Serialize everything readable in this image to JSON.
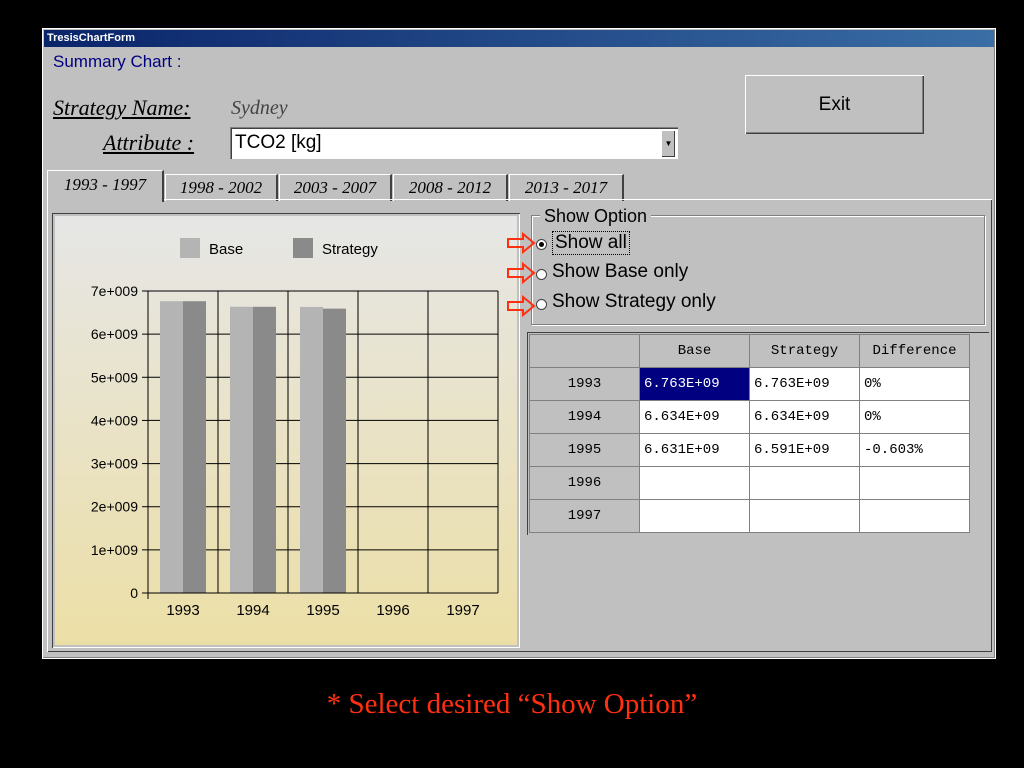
{
  "window": {
    "title": "TresisChartForm"
  },
  "header": {
    "summary_label": "Summary Chart :",
    "strategy_label": "Strategy Name:",
    "strategy_value": "Sydney",
    "attribute_label": "Attribute :",
    "attribute_value": "TCO2 [kg]",
    "exit_label": "Exit"
  },
  "tabs": [
    "1993 - 1997",
    "1998 - 2002",
    "2003 - 2007",
    "2008 - 2012",
    "2013 - 2017"
  ],
  "active_tab": 0,
  "show_option": {
    "title": "Show Option",
    "options": [
      "Show all",
      "Show Base only",
      "Show Strategy only"
    ],
    "selected": 0
  },
  "table": {
    "headers": [
      "",
      "Base",
      "Strategy",
      "Difference"
    ],
    "rows": [
      {
        "year": "1993",
        "base": "6.763E+09",
        "strategy": "6.763E+09",
        "diff": "0%"
      },
      {
        "year": "1994",
        "base": "6.634E+09",
        "strategy": "6.634E+09",
        "diff": "0%"
      },
      {
        "year": "1995",
        "base": "6.631E+09",
        "strategy": "6.591E+09",
        "diff": "-0.603%"
      },
      {
        "year": "1996",
        "base": "",
        "strategy": "",
        "diff": ""
      },
      {
        "year": "1997",
        "base": "",
        "strategy": "",
        "diff": ""
      }
    ]
  },
  "caption": "* Select desired “Show Option”",
  "colors": {
    "base": "#b4b4b4",
    "strategy": "#8a8a8a",
    "arrow": "#ff3010"
  },
  "chart_data": {
    "type": "bar",
    "categories": [
      "1993",
      "1994",
      "1995",
      "1996",
      "1997"
    ],
    "series": [
      {
        "name": "Base",
        "values": [
          6763000000.0,
          6634000000.0,
          6631000000.0,
          null,
          null
        ]
      },
      {
        "name": "Strategy",
        "values": [
          6763000000.0,
          6634000000.0,
          6591000000.0,
          null,
          null
        ]
      }
    ],
    "ylim": [
      0,
      7000000000.0
    ],
    "yticks": [
      0,
      1000000000.0,
      2000000000.0,
      3000000000.0,
      4000000000.0,
      5000000000.0,
      6000000000.0,
      7000000000.0
    ],
    "ytick_labels": [
      "0",
      "1e+009",
      "2e+009",
      "3e+009",
      "4e+009",
      "5e+009",
      "6e+009",
      "7e+009"
    ],
    "legend": "top",
    "grid": true
  }
}
